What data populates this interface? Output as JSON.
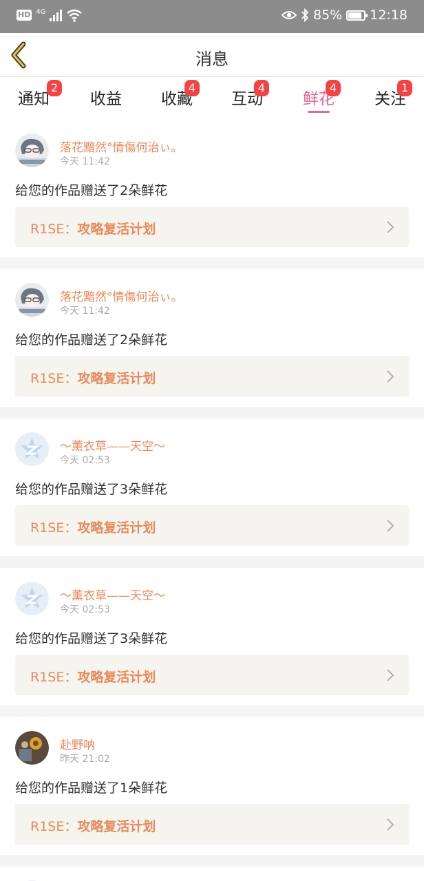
{
  "status_bar": {
    "hd": "HD",
    "network": "4G",
    "battery": "85%",
    "battery_level": 0.85,
    "time": "12:18"
  },
  "header": {
    "title": "消息",
    "back_icon": "chevron-left-icon"
  },
  "tabs": [
    {
      "label": "通知",
      "badge": "2",
      "active": false
    },
    {
      "label": "收益",
      "badge": "",
      "active": false
    },
    {
      "label": "收藏",
      "badge": "4",
      "active": false
    },
    {
      "label": "互动",
      "badge": "4",
      "active": false
    },
    {
      "label": "鲜花",
      "badge": "4",
      "active": true
    },
    {
      "label": "关注",
      "badge": "1",
      "active": false
    }
  ],
  "messages": [
    {
      "user": "落花黯然°情傷何治ぃ。",
      "time": "今天 11:42",
      "text": "给您的作品赠送了2朵鲜花",
      "work_prefix": "R1SE：",
      "work_title": "攻略复活计划",
      "avatar": "anime-avatar"
    },
    {
      "user": "落花黯然°情傷何治ぃ。",
      "time": "今天 11:42",
      "text": "给您的作品赠送了2朵鲜花",
      "work_prefix": "R1SE：",
      "work_title": "攻略复活计划",
      "avatar": "anime-avatar"
    },
    {
      "user": "～薰衣草——天空～",
      "time": "今天 02:53",
      "text": "给您的作品赠送了3朵鲜花",
      "work_prefix": "R1SE：",
      "work_title": "攻略复活计划",
      "avatar": "default-qq-avatar"
    },
    {
      "user": "～薰衣草——天空～",
      "time": "今天 02:53",
      "text": "给您的作品赠送了3朵鲜花",
      "work_prefix": "R1SE：",
      "work_title": "攻略复活计划",
      "avatar": "default-qq-avatar"
    },
    {
      "user": "赴野呐",
      "time": "昨天 21:02",
      "text": "给您的作品赠送了1朵鲜花",
      "work_prefix": "R1SE：",
      "work_title": "攻略复活计划",
      "avatar": "photo-avatar"
    }
  ]
}
